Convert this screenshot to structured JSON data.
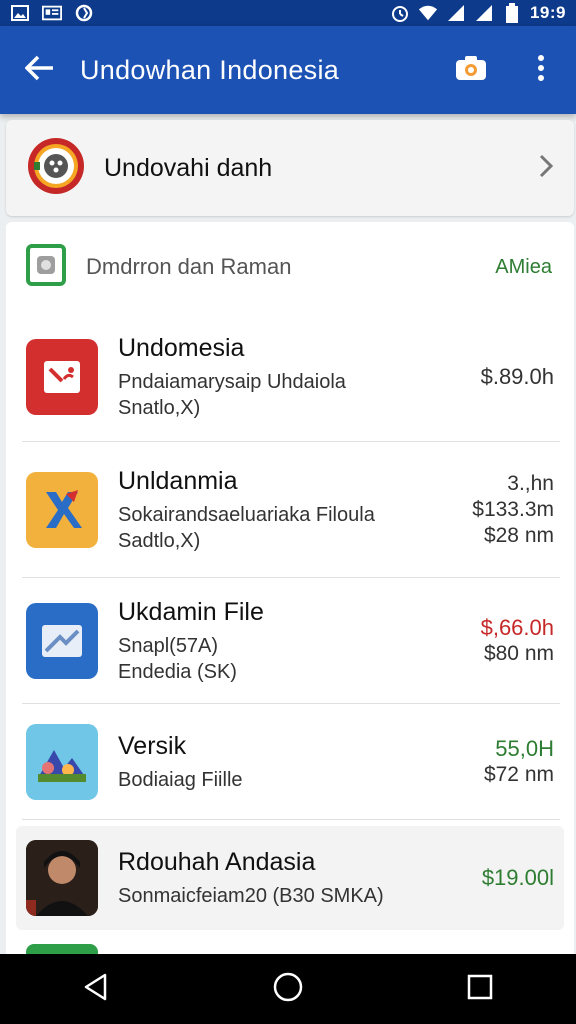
{
  "status_bar": {
    "time": "19:9",
    "icons": [
      "image-icon",
      "news-icon",
      "sync-icon",
      "alarm-icon",
      "wifi-icon",
      "signal-icon",
      "signal-icon",
      "battery-icon"
    ]
  },
  "app_bar": {
    "title": "Undowhan Indonesia",
    "back_icon": "arrow-back-icon",
    "actions": [
      "camera-icon",
      "more-vert-icon"
    ]
  },
  "header_card": {
    "title": "Undovahi danh",
    "icon": "emblem-icon"
  },
  "section": {
    "title": "Dmdrron dan Raman",
    "action": "AMiea"
  },
  "items": [
    {
      "name": "Undomesia",
      "sub1": "Pndaiamarysaip Uhdaiola",
      "sub2": "Snatlo,X)",
      "prices": [
        "$.89.0h"
      ],
      "icon": "image-broken-icon",
      "icon_color": "#d32f2f"
    },
    {
      "name": "Unldanmia",
      "sub1": "Sokairandsaeluariaka Filoula",
      "sub2": "Sadtlo,X)",
      "prices": [
        "3.,hn",
        "$133.3m",
        "$28 nm"
      ],
      "icon": "k-app-icon",
      "icon_color": "#f2b03c"
    },
    {
      "name": "Ukdamin File",
      "sub1": "Snapl(57A)",
      "sub2": "Endedia (SK)",
      "prices": [
        "$,66.0h",
        "$80 nm"
      ],
      "icon": "mail-icon",
      "icon_color": "#2a6dc6",
      "price_accent": "red"
    },
    {
      "name": "Versik",
      "sub1": "Bodiaiag Fiille",
      "sub2": "",
      "prices": [
        "55,0H",
        "$72 nm"
      ],
      "icon": "photo-app-icon",
      "icon_color": "#6fc6e6",
      "price_accent": "green"
    },
    {
      "name": "Rdouhah Andasia",
      "sub1": "Sonmaicfeiam20 (B30 SMKA)",
      "sub2": "",
      "prices": [
        "$19.00l"
      ],
      "icon": "portrait-icon",
      "icon_color": "#3a2a22",
      "price_accent": "green"
    }
  ],
  "nav_bar": [
    "back-nav-icon",
    "home-nav-icon",
    "recents-nav-icon"
  ]
}
